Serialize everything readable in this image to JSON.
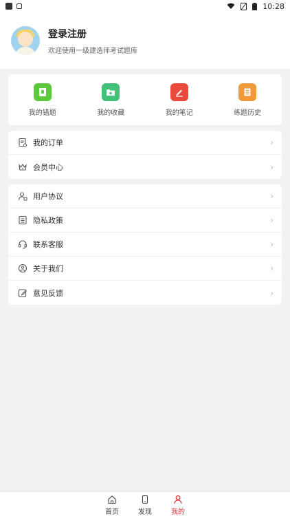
{
  "status_bar": {
    "time": "10:28"
  },
  "profile": {
    "title": "登录注册",
    "subtitle": "欢迎使用一级建造师考试题库"
  },
  "quick_actions": [
    {
      "label": "我的错题",
      "color": "#5cc83c",
      "icon": "book-icon"
    },
    {
      "label": "我的收藏",
      "color": "#43c07a",
      "icon": "folder-star-icon"
    },
    {
      "label": "我的笔记",
      "color": "#ea4a3c",
      "icon": "pencil-icon"
    },
    {
      "label": "练题历史",
      "color": "#f29a3a",
      "icon": "history-book-icon"
    }
  ],
  "list_group_1": [
    {
      "label": "我的订单",
      "icon": "order-icon"
    },
    {
      "label": "会员中心",
      "icon": "crown-icon"
    }
  ],
  "list_group_2": [
    {
      "label": "用户协议",
      "icon": "user-agreement-icon"
    },
    {
      "label": "隐私政策",
      "icon": "privacy-doc-icon"
    },
    {
      "label": "联系客服",
      "icon": "headset-icon"
    },
    {
      "label": "关于我们",
      "icon": "about-icon"
    },
    {
      "label": "意见反馈",
      "icon": "feedback-edit-icon"
    }
  ],
  "tabbar": [
    {
      "label": "首页",
      "icon": "home-icon"
    },
    {
      "label": "发现",
      "icon": "phone-icon"
    },
    {
      "label": "我的",
      "icon": "person-icon",
      "active": true
    }
  ],
  "colors": {
    "accent": "#e23b3b"
  }
}
